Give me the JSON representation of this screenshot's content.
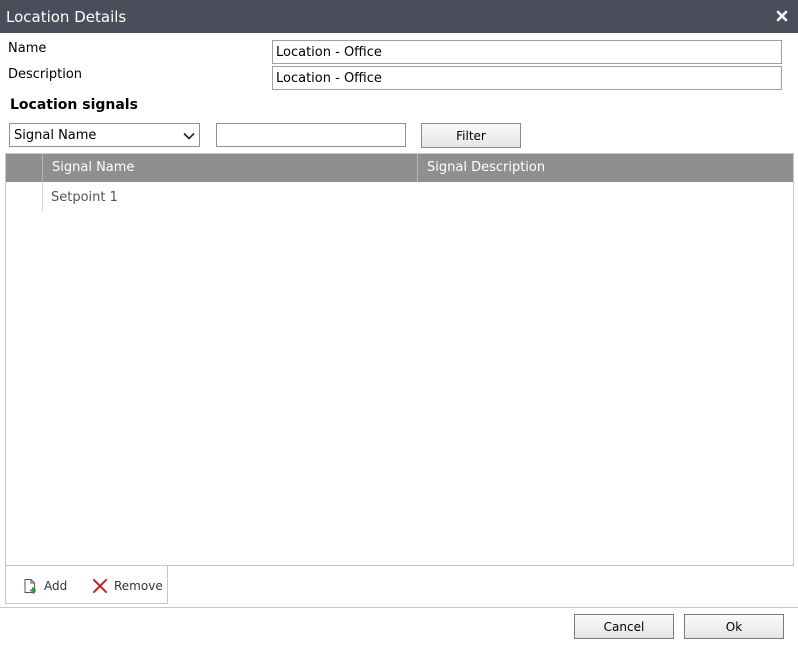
{
  "dialog": {
    "title": "Location Details"
  },
  "form": {
    "name_label": "Name",
    "name_value": "Location - Office",
    "description_label": "Description",
    "description_value": "Location - Office"
  },
  "signals": {
    "section_title": "Location signals",
    "filter_field_selected": "Signal Name",
    "filter_text": "",
    "filter_button": "Filter",
    "columns": [
      "Signal Name",
      "Signal Description"
    ],
    "rows": [
      {
        "name": "Setpoint 1",
        "description": ""
      }
    ],
    "add_label": "Add",
    "remove_label": "Remove"
  },
  "footer": {
    "cancel_label": "Cancel",
    "ok_label": "Ok"
  },
  "colors": {
    "titlebar": "#4a4e5a",
    "grid_header": "#8f8f8f",
    "remove_icon": "#c0282d",
    "add_icon_plus": "#2e9e3e"
  },
  "icons": {
    "close": "close-icon",
    "dropdown": "chevron-down-icon",
    "add": "add-document-icon",
    "remove": "remove-x-icon"
  }
}
